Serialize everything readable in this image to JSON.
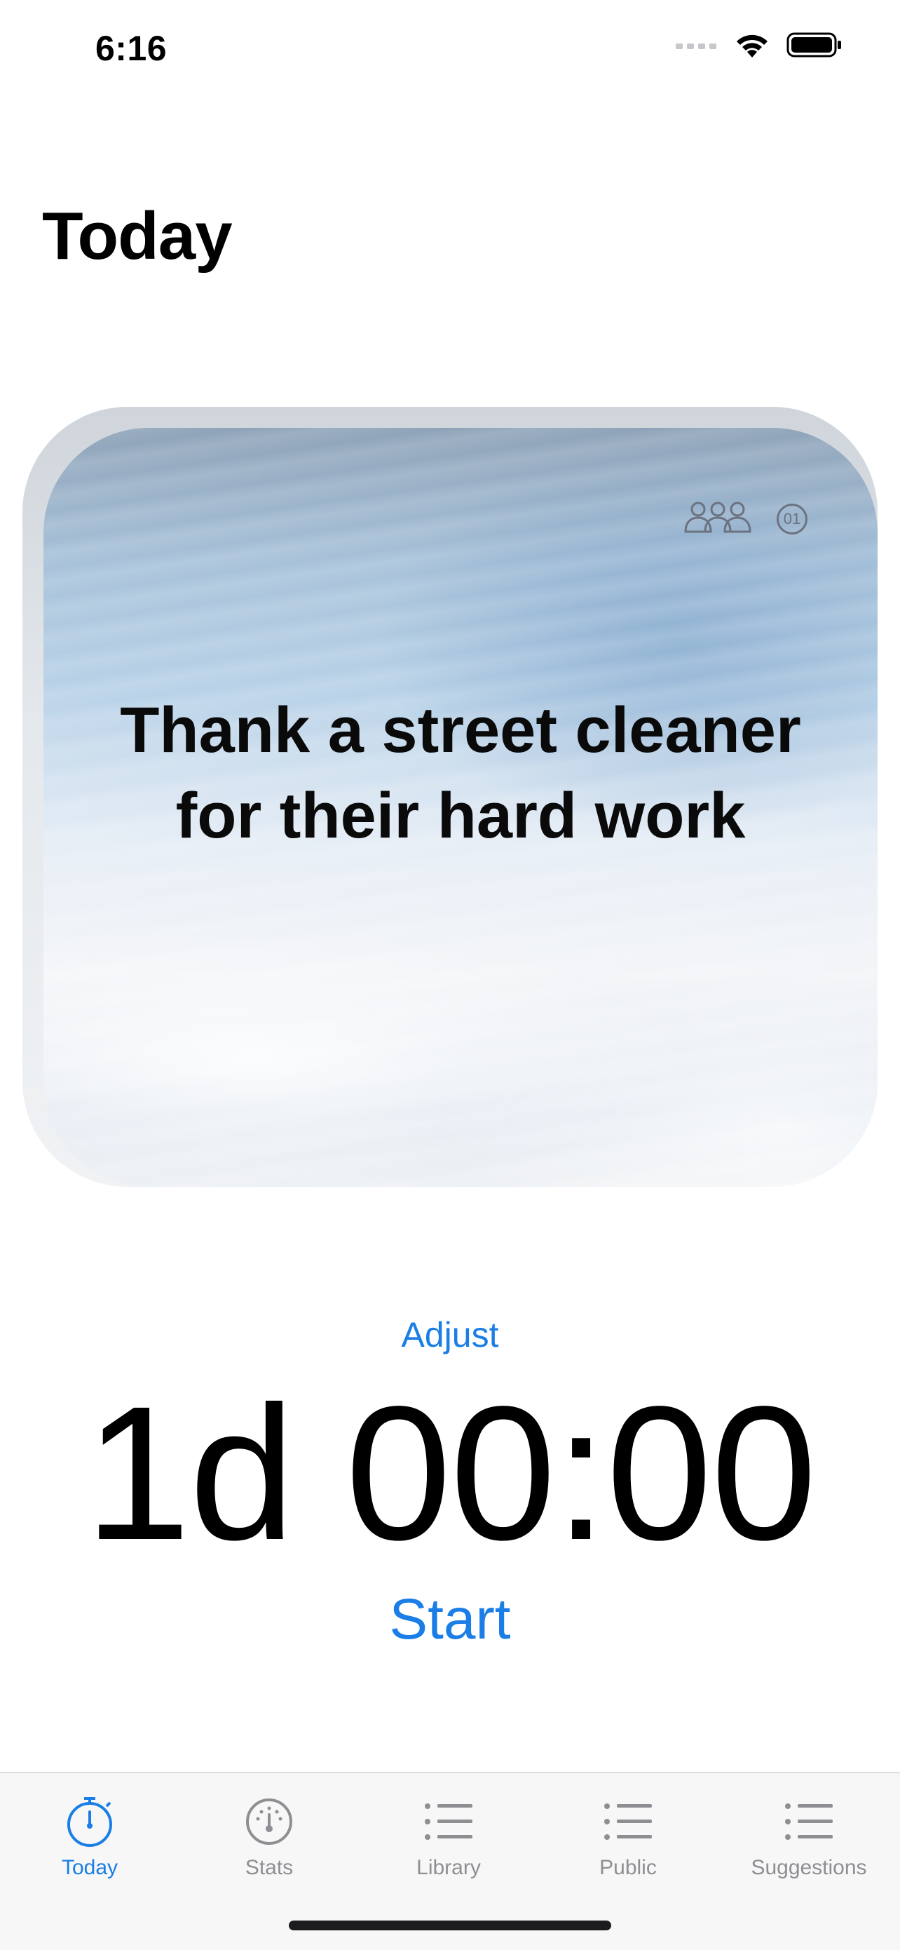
{
  "status_bar": {
    "time": "6:16"
  },
  "page": {
    "title": "Today"
  },
  "card": {
    "text": "Thank a street cleaner for their hard work",
    "badge_number": "01",
    "icons": [
      "people-group-icon",
      "number-badge-icon"
    ]
  },
  "timer": {
    "adjust_label": "Adjust",
    "value": "1d 00:00",
    "start_label": "Start"
  },
  "tab_bar": {
    "tabs": [
      {
        "label": "Today",
        "icon": "stopwatch-icon",
        "active": true
      },
      {
        "label": "Stats",
        "icon": "gauge-icon",
        "active": false
      },
      {
        "label": "Library",
        "icon": "list-icon",
        "active": false
      },
      {
        "label": "Public",
        "icon": "list-icon",
        "active": false
      },
      {
        "label": "Suggestions",
        "icon": "list-icon",
        "active": false
      }
    ]
  },
  "colors": {
    "accent": "#1a7ee6",
    "inactive_tab": "#8e8e93"
  }
}
